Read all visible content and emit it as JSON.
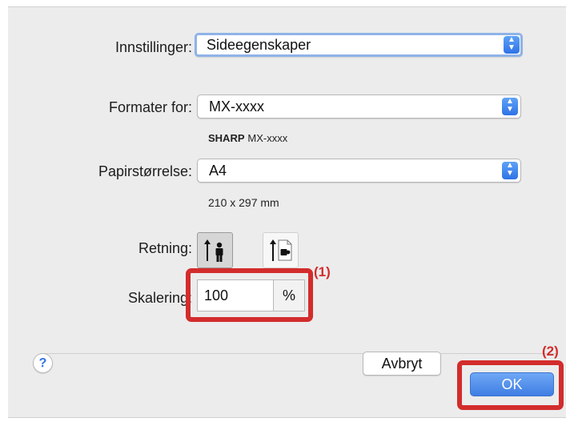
{
  "dialog": {
    "settings": {
      "label": "Innstillinger:",
      "value": "Sideegenskaper"
    },
    "format_for": {
      "label": "Formater for:",
      "value": "MX-xxxx",
      "sub_brand": "SHARP",
      "sub_model": "MX-xxxx"
    },
    "paper_size": {
      "label": "Papirstørrelse:",
      "value": "A4",
      "dimensions": "210 x 297 mm"
    },
    "orientation": {
      "label": "Retning:",
      "selected": "portrait"
    },
    "scaling": {
      "label": "Skalering:",
      "value": "100",
      "unit": "%"
    },
    "help_glyph": "?",
    "cancel_label": "Avbryt",
    "ok_label": "OK"
  },
  "annotations": {
    "callout_1": "(1)",
    "callout_2": "(2)"
  },
  "colors": {
    "accent": "#2f73e6",
    "highlight": "#d32c2c",
    "dialog_bg": "#ececec"
  }
}
